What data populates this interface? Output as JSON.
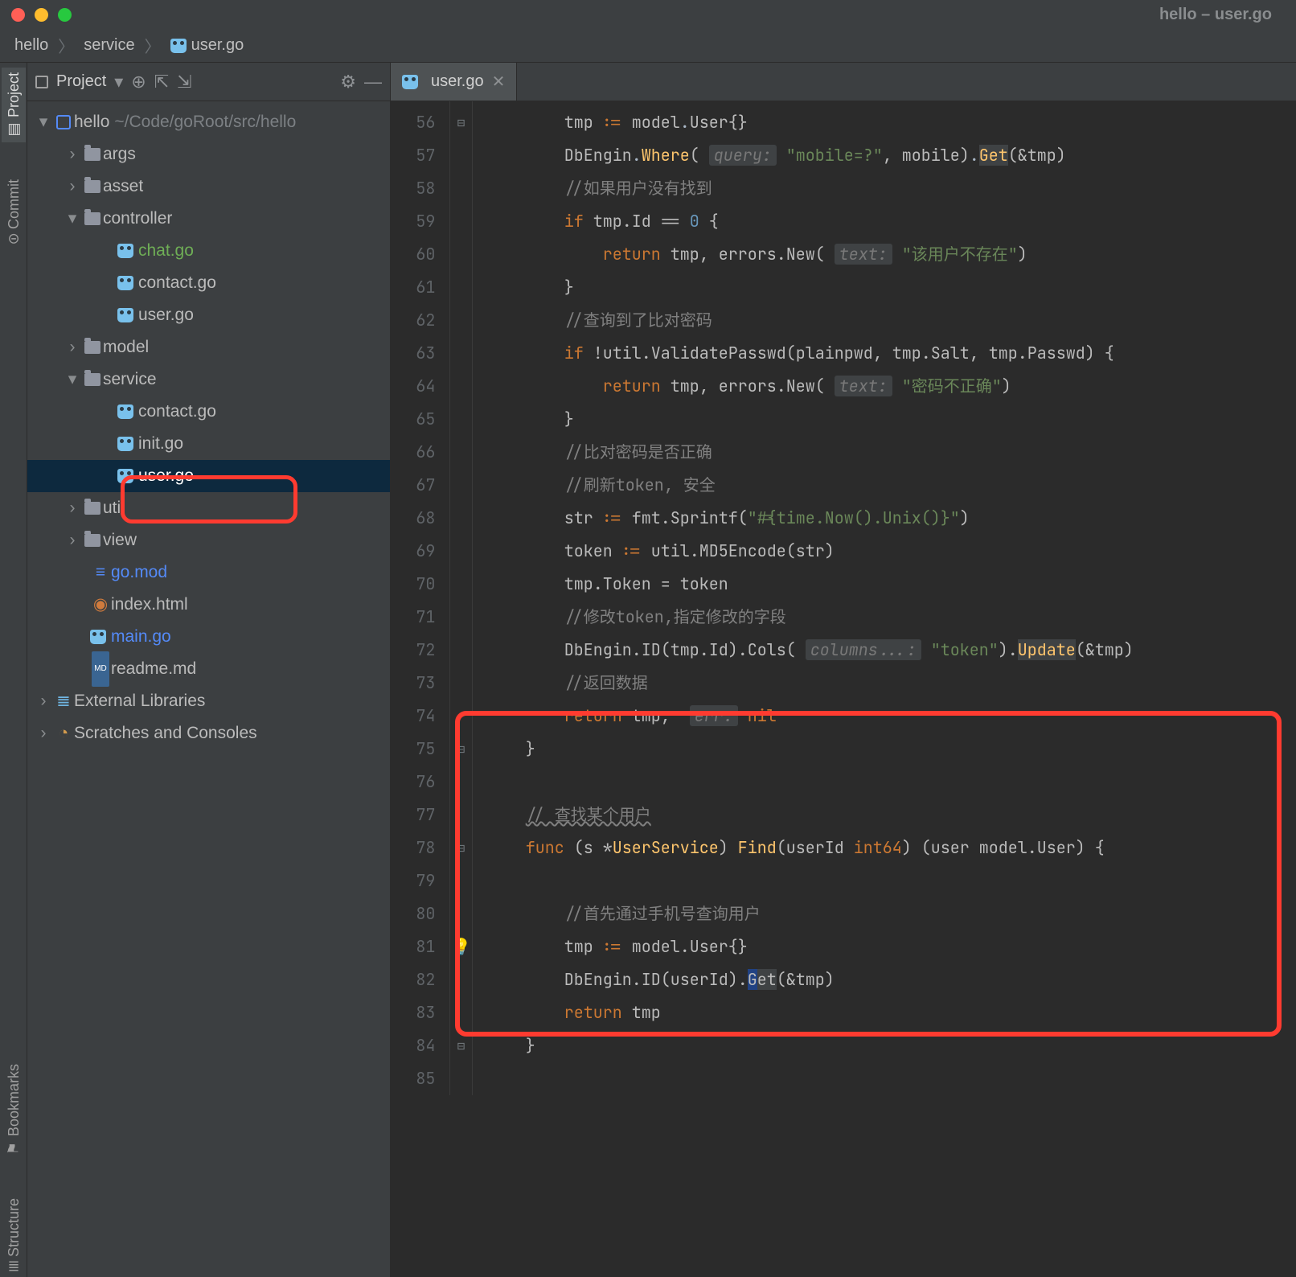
{
  "window": {
    "title": "hello – user.go"
  },
  "breadcrumb": {
    "root": "hello",
    "mid": "service",
    "file": "user.go"
  },
  "toolstrip": {
    "project": "Project",
    "commit": "Commit",
    "bookmarks": "Bookmarks",
    "structure": "Structure"
  },
  "sidebar": {
    "title": "Project",
    "tree": {
      "project": "hello",
      "project_path": "~/Code/goRoot/src/hello",
      "args_dir": "args",
      "asset_dir": "asset",
      "controller_dir": "controller",
      "controller_files": {
        "chat": "chat.go",
        "contact": "contact.go",
        "user": "user.go"
      },
      "model_dir": "model",
      "service_dir": "service",
      "service_files": {
        "contact": "contact.go",
        "init": "init.go",
        "user": "user.go"
      },
      "util_dir": "util",
      "view_dir": "view",
      "gomod": "go.mod",
      "index": "index.html",
      "main": "main.go",
      "readme": "readme.md",
      "ext_libs": "External Libraries",
      "scratches": "Scratches and Consoles"
    }
  },
  "editor": {
    "tab": "user.go",
    "first_line": 56,
    "intention_line": 81,
    "caret_line": 82,
    "lines": [
      {
        "n": 56,
        "html": "        tmp <span class='c-kw'>:=</span> model<span class='c-id'>.</span>User{}",
        "fold": "open"
      },
      {
        "n": 57,
        "html": "        DbEngin<span class='c-id'>.</span><span class='c-fn'>Where</span>( <span class='c-hint'>query:</span> <span class='c-str'>\"mobile=?\"</span>, mobile)<span class='c-id'>.</span><span class='c-fn c-dim'>Get</span>(&amp;tmp)"
      },
      {
        "n": 58,
        "html": "        <span class='c-com'>//如果用户没有找到</span>"
      },
      {
        "n": 59,
        "html": "        <span class='c-kw'>if</span> tmp.Id == <span class='c-num'>0</span> {"
      },
      {
        "n": 60,
        "html": "            <span class='c-kw'>return</span> tmp, errors.New( <span class='c-hint'>text:</span> <span class='c-str'>\"该用户不存在\"</span>)"
      },
      {
        "n": 61,
        "html": "        }"
      },
      {
        "n": 62,
        "html": "        <span class='c-com'>//查询到了比对密码</span>"
      },
      {
        "n": 63,
        "html": "        <span class='c-kw'>if</span> !util.ValidatePasswd(plainpwd, tmp.Salt, tmp.Passwd) {"
      },
      {
        "n": 64,
        "html": "            <span class='c-kw'>return</span> tmp, errors.New( <span class='c-hint'>text:</span> <span class='c-str'>\"密码不正确\"</span>)"
      },
      {
        "n": 65,
        "html": "        }"
      },
      {
        "n": 66,
        "html": "        <span class='c-com'>//比对密码是否正确</span>"
      },
      {
        "n": 67,
        "html": "        <span class='c-com'>//刷新token, 安全</span>"
      },
      {
        "n": 68,
        "html": "        str <span class='c-kw'>:=</span> fmt.Sprintf(<span class='c-str'>\"#{time.Now().Unix()}\"</span>)"
      },
      {
        "n": 69,
        "html": "        token <span class='c-kw'>:=</span> util.MD5Encode(str)"
      },
      {
        "n": 70,
        "html": "        tmp.Token = token"
      },
      {
        "n": 71,
        "html": "        <span class='c-com'>//修改token,指定修改的字段</span>"
      },
      {
        "n": 72,
        "html": "        DbEngin.ID(tmp.Id).Cols( <span class='c-hint'>columns...:</span> <span class='c-str'>\"token\"</span>).<span class='c-fn c-dim'>Update</span>(&amp;tmp)"
      },
      {
        "n": 73,
        "html": "        <span class='c-com'>//返回数据</span>"
      },
      {
        "n": 74,
        "html": "        <span class='c-kw'>return</span> tmp,  <span class='c-hint'>err:</span> <span class='c-kw'>nil</span>"
      },
      {
        "n": 75,
        "html": "    }",
        "fold": "close"
      },
      {
        "n": 76,
        "html": ""
      },
      {
        "n": 77,
        "html": "    <span class='c-com underl'>// 查找某个用户</span>"
      },
      {
        "n": 78,
        "html": "    <span class='c-kw'>func</span> (s *<span class='c-fn'>UserService</span>) <span class='c-fn'>Find</span>(userId <span class='c-kw'>int64</span>) (user model.User) {",
        "fold": "open"
      },
      {
        "n": 79,
        "html": ""
      },
      {
        "n": 80,
        "html": "        <span class='c-com'>//首先通过手机号查询用户</span>"
      },
      {
        "n": 81,
        "html": "        tmp <span class='c-kw'>:=</span> model.User{}"
      },
      {
        "n": 82,
        "html": "        DbEngin.ID(userId).<span class='c-caret'>G</span><span class='c-dim'>et</span>(&amp;tmp)"
      },
      {
        "n": 83,
        "html": "        <span class='c-kw'>return</span> tmp"
      },
      {
        "n": 84,
        "html": "    }",
        "fold": "close"
      },
      {
        "n": 85,
        "html": ""
      }
    ]
  }
}
